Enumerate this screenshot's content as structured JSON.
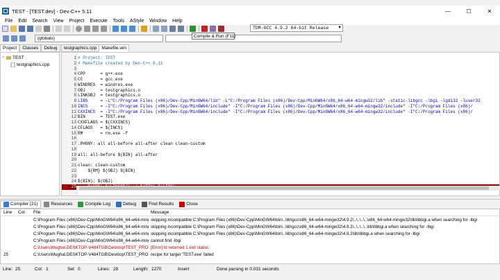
{
  "window": {
    "title": "TEST - [TEST.dev] - Dev-C++ 5.11",
    "minimize": "—",
    "maximize": "☐",
    "close": "✕"
  },
  "menu": [
    "File",
    "Edit",
    "Search",
    "View",
    "Project",
    "Execute",
    "Tools",
    "AStyle",
    "Window",
    "Help"
  ],
  "toolbar": {
    "compiler": "TDM-GCC 4.9.2 64-bit Release",
    "globals": "(globals)",
    "tooltip": "Compile & Run (F11)"
  },
  "left_panel": {
    "tabs": [
      "Project",
      "Classes",
      "Debug"
    ],
    "tree": [
      {
        "label": "TEST",
        "level": 0
      },
      {
        "label": "testgraphics.cpp",
        "level": 1
      }
    ]
  },
  "editor": {
    "tabs": [
      "testgraphics.cpp",
      "Makefile.win"
    ],
    "active_tab": 1,
    "lines": [
      {
        "n": "1",
        "text": "# Project: TEST",
        "cls": "c-comment"
      },
      {
        "n": "2",
        "text": "# Makefile created by Dev-C++ 5.11",
        "cls": "c-comment"
      },
      {
        "n": "3",
        "text": "",
        "cls": "c-black"
      },
      {
        "n": "4",
        "text": "CPP      = g++.exe",
        "cls": "c-black"
      },
      {
        "n": "5",
        "text": "CC       = gcc.exe",
        "cls": "c-black"
      },
      {
        "n": "6",
        "text": "WINDRES  = windres.exe",
        "cls": "c-black"
      },
      {
        "n": "7",
        "text": "OBJ      = testgraphics.o",
        "cls": "c-black"
      },
      {
        "n": "8",
        "text": "LINKOBJ  = testgraphics.o",
        "cls": "c-black"
      },
      {
        "n": "9",
        "text": "LIBS     = -L\"C:/Program Files (x86)/Dev-Cpp/MinGW64/lib\" -L\"C:/Program Files (x86)/Dev-Cpp/MinGW64/x86_64-w64-mingw32/lib\" -static-libgcc -lbgi -lgdi32 -luser32",
        "cls": "c-blue"
      },
      {
        "n": "10",
        "text": "INCS     = -I\"C:/Program Files (x86)/Dev-Cpp/MinGW64/include\" -I\"C:/Program Files (x86)/Dev-Cpp/MinGW64/x86_64-w64-mingw32/include\" -I\"C:/Program Files (x86)/",
        "cls": "c-blue"
      },
      {
        "n": "11",
        "text": "CXXINCS  = -I\"C:/Program Files (x86)/Dev-Cpp/MinGW64/include\" -I\"C:/Program Files (x86)/Dev-Cpp/MinGW64/x86_64-w64-mingw32/include\" -I\"C:/Program Files (x86)/",
        "cls": "c-blue"
      },
      {
        "n": "12",
        "text": "BIN      = TEST.exe",
        "cls": "c-black"
      },
      {
        "n": "13",
        "text": "CXXFLAGS = $(CXXINCS)",
        "cls": "c-black"
      },
      {
        "n": "14",
        "text": "CFLAGS   = $(INCS)",
        "cls": "c-black"
      },
      {
        "n": "15",
        "text": "RM       = rm.exe -f",
        "cls": "c-black"
      },
      {
        "n": "16",
        "text": "",
        "cls": "c-black"
      },
      {
        "n": "17",
        "text": ".PHONY: all all-before all-after clean clean-custom",
        "cls": "c-black"
      },
      {
        "n": "18",
        "text": "",
        "cls": "c-black"
      },
      {
        "n": "19",
        "text": "all: all-before $(BIN) all-after",
        "cls": "c-black"
      },
      {
        "n": "20",
        "text": "",
        "cls": "c-black"
      },
      {
        "n": "21",
        "text": "clean: clean-custom",
        "cls": "c-black"
      },
      {
        "n": "22",
        "text": "    ${RM} $(OBJ) $(BIN)",
        "cls": "c-black"
      },
      {
        "n": "23",
        "text": "",
        "cls": "c-black"
      },
      {
        "n": "24",
        "text": "$(BIN): $(OBJ)",
        "cls": "c-black"
      },
      {
        "n": "25",
        "text": "    $(CPP) $(LINKOBJ) -o $(BIN) $(LIBS)",
        "cls": "c-black",
        "highlight": true
      }
    ]
  },
  "bottom_tabs": [
    {
      "label": "Compiler (21)",
      "icon": "compiler-icon",
      "color": "#3a7bd5"
    },
    {
      "label": "Resources",
      "icon": "resources-icon",
      "color": "#888888"
    },
    {
      "label": "Compile Log",
      "icon": "compile-log-icon",
      "color": "#2a9d3a"
    },
    {
      "label": "Debug",
      "icon": "debug-icon",
      "color": "#2c6fbf"
    },
    {
      "label": "Find Results",
      "icon": "find-results-icon",
      "color": "#555555"
    },
    {
      "label": "Close",
      "icon": "close-icon",
      "color": "#cc0000"
    }
  ],
  "messages": {
    "headers": {
      "line": "Line",
      "col": "Col",
      "file": "File",
      "message": "Message"
    },
    "rows": [
      {
        "line": "",
        "col": "",
        "file": "C:\\Program Files (x86)\\Dev-Cpp\\MinGW64\\x86_64-w64-mingw32...",
        "message": "skipping incompatible C:\\Program Files (x86)\\Dev-Cpp\\MinGW64\\bin\\..\\lib\\gcc\\x86_64-w64-mingw32\\4.9.2\\..\\..\\..\\..\\x86_64-w64-mingw32\\lib\\libbgi.a when searching for -lbgi",
        "error": false
      },
      {
        "line": "",
        "col": "",
        "file": "C:\\Program Files (x86)\\Dev-Cpp\\MinGW64\\x86_64-w64-mingw32...",
        "message": "skipping incompatible C:\\Program Files (x86)\\Dev-Cpp\\MinGW64\\bin\\..\\lib\\gcc\\x86_64-w64-mingw32\\4.9.2\\..\\..\\..\\..\\lib\\libbgi.a when searching for -lbgi",
        "error": false
      },
      {
        "line": "",
        "col": "",
        "file": "C:\\Program Files (x86)\\Dev-Cpp\\MinGW64\\x86_64-w64-mingw32...",
        "message": "skipping incompatible C:\\Program Files (x86)\\Dev-Cpp\\MinGW64\\bin\\..\\lib\\gcc\\x86_64-w64-mingw32\\4.9.2\\lib\\libbgi.a when searching for -lbgi",
        "error": false
      },
      {
        "line": "",
        "col": "",
        "file": "C:\\Program Files (x86)\\Dev-Cpp\\MinGW64\\x86_64-w64-mingw32...",
        "message": "cannot find -lbgi",
        "error": false
      },
      {
        "line": "",
        "col": "",
        "file": "C:\\Users\\Mughal.DESKTOP-V484TGB\\Desktop\\TEST_PRO...",
        "message": "[Error] ld returned 1 exit status",
        "error": true
      },
      {
        "line": "25",
        "col": "",
        "file": "C:\\Users\\Mughal.DESKTOP-V484TGB\\Desktop\\TEST_PRO...",
        "message": "recipe for target 'TEST.exe' failed",
        "error": false
      }
    ]
  },
  "status": {
    "line_label": "Line:",
    "line_value": "25",
    "col_label": "Col:",
    "col_value": "1",
    "sel_label": "Sel:",
    "sel_value": "0",
    "lines_label": "Lines:",
    "lines_value": "28",
    "length_label": "Length:",
    "length_value": "1270",
    "mode": "Insert",
    "message": "Done parsing in 0.031 seconds"
  },
  "colors": {
    "highlight_line": "#8b0000",
    "comment": "#1e6fb8",
    "string_path": "#0000c0",
    "error_text": "#d00000"
  }
}
